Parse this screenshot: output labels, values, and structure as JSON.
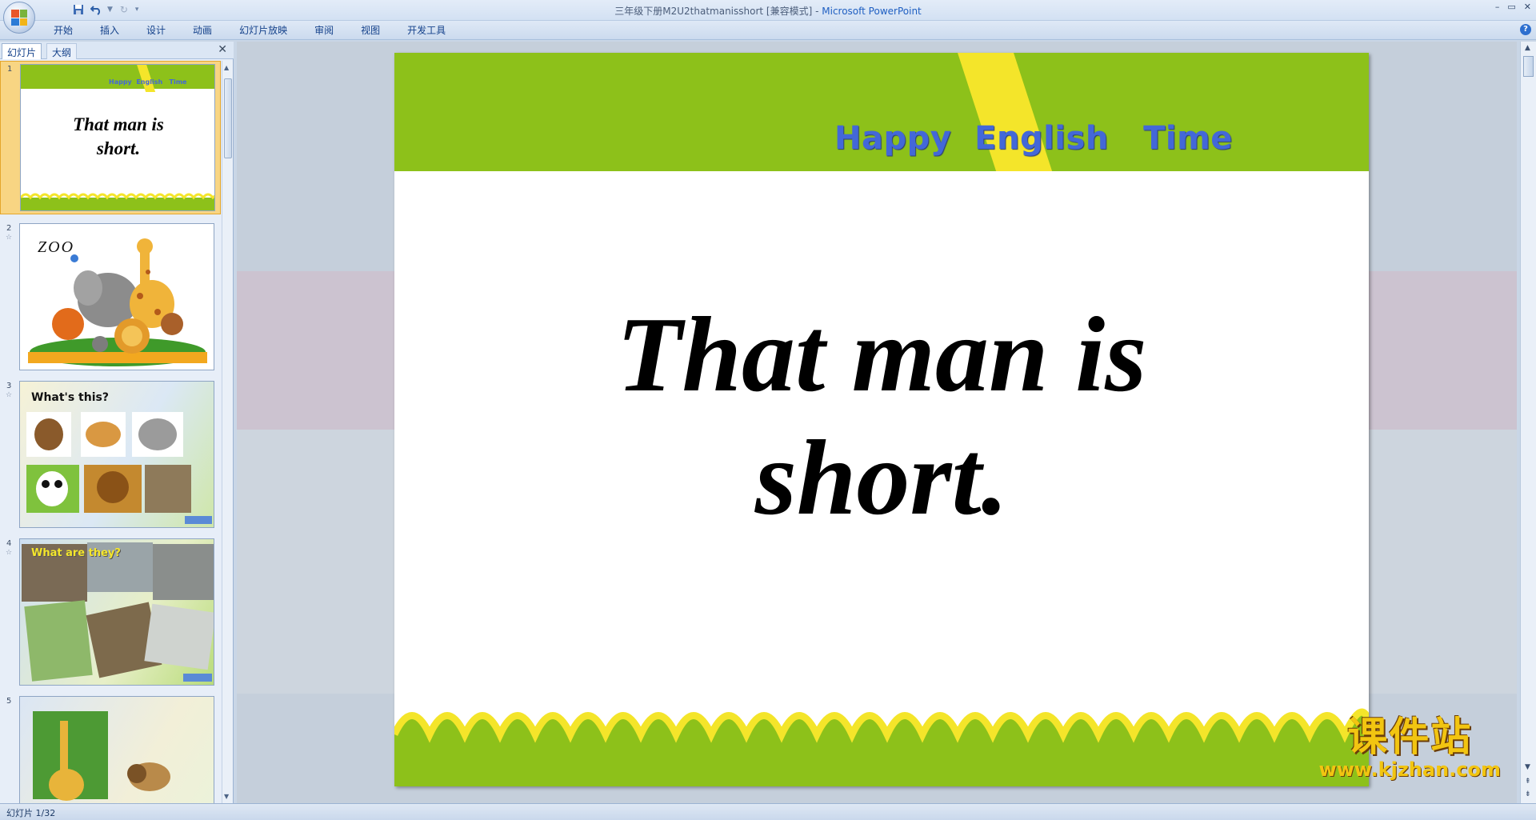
{
  "window": {
    "title_doc": "三年级下册M2U2thatmanisshort [兼容模式]",
    "title_sep": " - ",
    "title_app": "Microsoft PowerPoint",
    "controls": [
      "–",
      "▭",
      "✕"
    ]
  },
  "ribbon": {
    "tabs": [
      "开始",
      "插入",
      "设计",
      "动画",
      "幻灯片放映",
      "审阅",
      "视图",
      "开发工具"
    ],
    "help": "?"
  },
  "left_pane": {
    "tabs": [
      "幻灯片",
      "大纲"
    ],
    "close": "✕",
    "slides": [
      {
        "num": "1",
        "header": "Happy  English   Time",
        "title_line1": "That man is",
        "title_line2": "short."
      },
      {
        "num": "2",
        "text": "ZOO"
      },
      {
        "num": "3",
        "text": "What's this?"
      },
      {
        "num": "4",
        "text": "What are they?"
      },
      {
        "num": "5"
      }
    ]
  },
  "slide": {
    "header": "Happy  English   Time",
    "title_line1": "That man is",
    "title_line2": "short."
  },
  "watermark": {
    "cn": "课件站",
    "url": "www.kjzhan.com"
  },
  "status": {
    "text": "幻灯片 1/32"
  },
  "colors": {
    "green": "#8dc11a",
    "yellow": "#f4e52a",
    "header_text": "#4368d8"
  }
}
